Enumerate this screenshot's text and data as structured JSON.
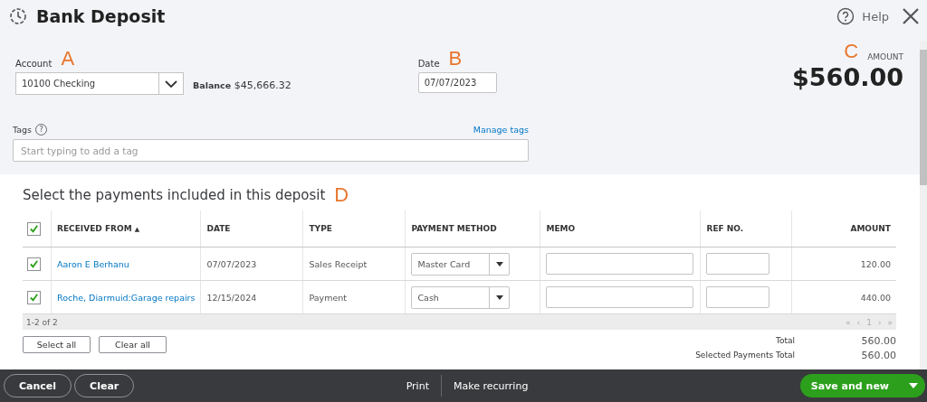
{
  "window": {
    "title": "Bank Deposit",
    "help": "Help"
  },
  "markers": [
    "A",
    "B",
    "C",
    "D"
  ],
  "account": {
    "label": "Account",
    "value": "10100 Checking",
    "balance_label": "Balance",
    "balance": "$45,666.32"
  },
  "date": {
    "label": "Date",
    "value": "07/07/2023"
  },
  "amount": {
    "label": "AMOUNT",
    "value": "$560.00"
  },
  "tags": {
    "label": "Tags",
    "help": "?",
    "link": "Manage tags",
    "placeholder": "Start typing to add a tag"
  },
  "payments": {
    "title": "Select the payments included in this deposit",
    "all_checked": true,
    "columns": [
      "RECEIVED FROM",
      "DATE",
      "TYPE",
      "PAYMENT METHOD",
      "MEMO",
      "REF NO.",
      "AMOUNT"
    ],
    "sort_indicator": "▲",
    "rows": [
      {
        "checked": true,
        "received_from": "Aaron E Berhanu",
        "date": "07/07/2023",
        "type": "Sales Receipt",
        "payment_method": "Master Card",
        "amount": "120.00"
      },
      {
        "checked": true,
        "received_from": "Roche, Diarmuid:Garage repairs",
        "date": "12/15/2024",
        "type": "Payment",
        "payment_method": "Cash",
        "amount": "440.00"
      }
    ],
    "count": "1-2 of 2",
    "pager": [
      "«",
      "‹",
      "1",
      "›",
      "»"
    ],
    "buttons": [
      "Select all",
      "Clear all"
    ],
    "totals": [
      {
        "label": "Total",
        "value": "560.00"
      },
      {
        "label": "Selected Payments Total",
        "value": "560.00"
      }
    ]
  },
  "footer": {
    "left": [
      "Cancel",
      "Clear"
    ],
    "center": [
      "Print",
      "Make recurring"
    ],
    "primary": "Save and new"
  }
}
